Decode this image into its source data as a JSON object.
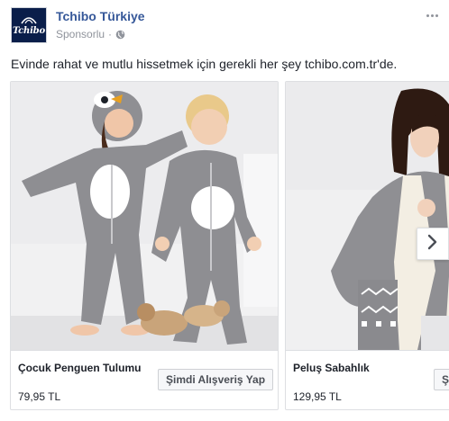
{
  "post": {
    "page_name": "Tchibo Türkiye",
    "sponsored_label": "Sponsorlu",
    "separator": "·",
    "logo_text": "Tchibo",
    "caption": "Evinde rahat ve mutlu hissetmek için gerekli her şey tchibo.com.tr'de."
  },
  "cards": [
    {
      "title": "Çocuk Penguen Tulumu",
      "price": "79,95 TL",
      "cta_label": "Şimdi Alışveriş Yap",
      "image": "kids-penguin-onesie-photo"
    },
    {
      "title": "Peluş Sabahlık",
      "price": "129,95 TL",
      "cta_label": "Şimdi Alışveriş Yap",
      "image": "woman-plush-robe-photo"
    }
  ],
  "icons": {
    "globe": "globe-icon",
    "more": "more-options-icon",
    "next": "chevron-right-icon"
  },
  "colors": {
    "page_name": "#365899",
    "meta": "#90949c",
    "logo_bg": "#0a1e4a",
    "text": "#1d2129"
  }
}
